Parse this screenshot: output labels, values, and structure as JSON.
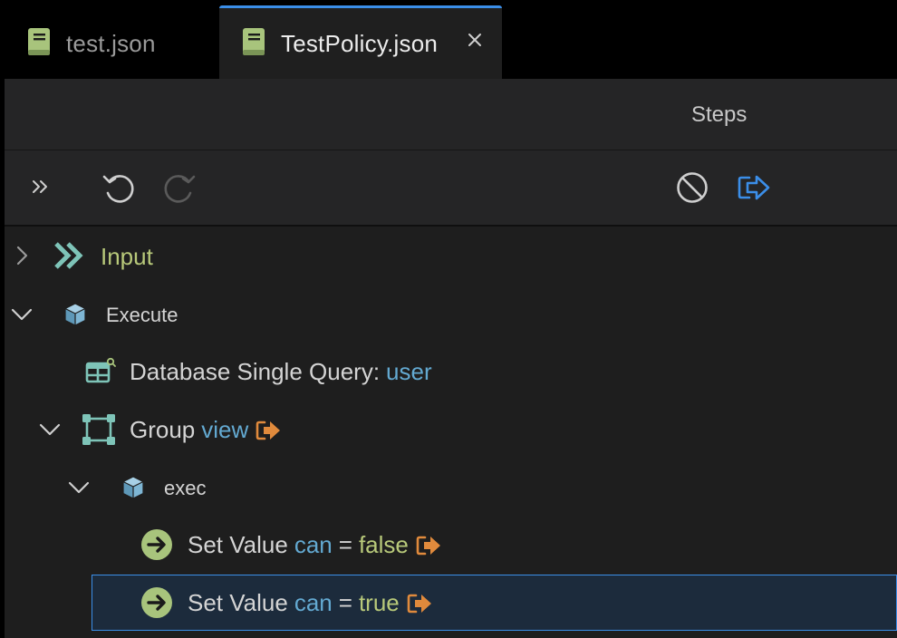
{
  "tabs": [
    {
      "label": "test.json",
      "active": false
    },
    {
      "label": "TestPolicy.json",
      "active": true
    }
  ],
  "panel": {
    "title": "Steps"
  },
  "toolbar": {
    "icons": [
      "expand-panel-icon",
      "undo-icon",
      "redo-icon",
      "disable-icon",
      "exit-step-icon"
    ]
  },
  "tree": {
    "input": {
      "label": "Input"
    },
    "execute": {
      "label": "Execute"
    },
    "db_query": {
      "label": "Database Single Query:",
      "target": "user"
    },
    "group": {
      "label": "Group",
      "name": "view"
    },
    "exec": {
      "label": "exec"
    },
    "set_value_1": {
      "label": "Set Value",
      "var": "can",
      "op": "=",
      "value": "false"
    },
    "set_value_2": {
      "label": "Set Value",
      "var": "can",
      "op": "=",
      "value": "true"
    }
  },
  "colors": {
    "accent_blue": "#3b8ee8",
    "icon_teal": "#7ec4b8",
    "icon_green": "#a8c47c",
    "exit_orange": "#e08a3c",
    "text_green": "#b8c97a",
    "text_blue": "#63a9d1"
  }
}
